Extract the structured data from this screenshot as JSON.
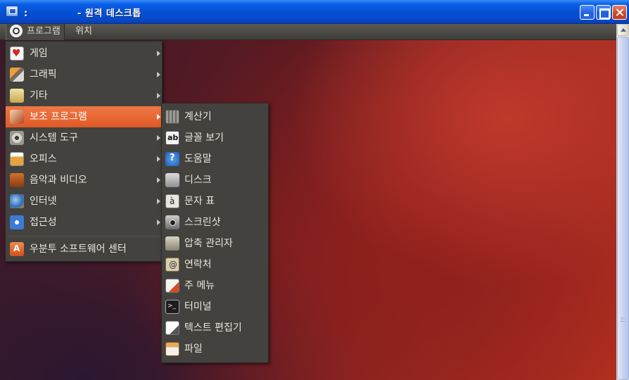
{
  "window": {
    "title": ":              - 원격 데스크톱"
  },
  "panel": {
    "programs_label": "프로그램",
    "places_label": "위치"
  },
  "main_menu": {
    "items": [
      {
        "label": "게임",
        "icon": "game-icon"
      },
      {
        "label": "그래픽",
        "icon": "graphics-icon"
      },
      {
        "label": "기타",
        "icon": "other-icon"
      },
      {
        "label": "보조 프로그램",
        "icon": "accessories-icon",
        "active": true
      },
      {
        "label": "시스템 도구",
        "icon": "system-tools-icon"
      },
      {
        "label": "오피스",
        "icon": "office-icon"
      },
      {
        "label": "음악과 비디오",
        "icon": "sound-video-icon"
      },
      {
        "label": "인터넷",
        "icon": "internet-icon"
      },
      {
        "label": "접근성",
        "icon": "accessibility-icon"
      }
    ],
    "software_center": "우분투 소프트웨어 센터"
  },
  "sub_menu": {
    "items": [
      {
        "label": "계산기",
        "icon": "calculator-icon"
      },
      {
        "label": "글꼴 보기",
        "icon": "font-viewer-icon"
      },
      {
        "label": "도움말",
        "icon": "help-icon"
      },
      {
        "label": "디스크",
        "icon": "disk-icon"
      },
      {
        "label": "문자 표",
        "icon": "character-map-icon"
      },
      {
        "label": "스크린샷",
        "icon": "screenshot-icon"
      },
      {
        "label": "압축 관리자",
        "icon": "archive-manager-icon"
      },
      {
        "label": "연락처",
        "icon": "contacts-icon"
      },
      {
        "label": "주 메뉴",
        "icon": "main-menu-icon"
      },
      {
        "label": "터미널",
        "icon": "terminal-icon"
      },
      {
        "label": "텍스트 편집기",
        "icon": "text-editor-icon"
      },
      {
        "label": "파일",
        "icon": "files-icon"
      }
    ]
  },
  "colors": {
    "menu_bg": "#43423e",
    "highlight": "#e8672f",
    "xp_titlebar": "#0552d8"
  }
}
